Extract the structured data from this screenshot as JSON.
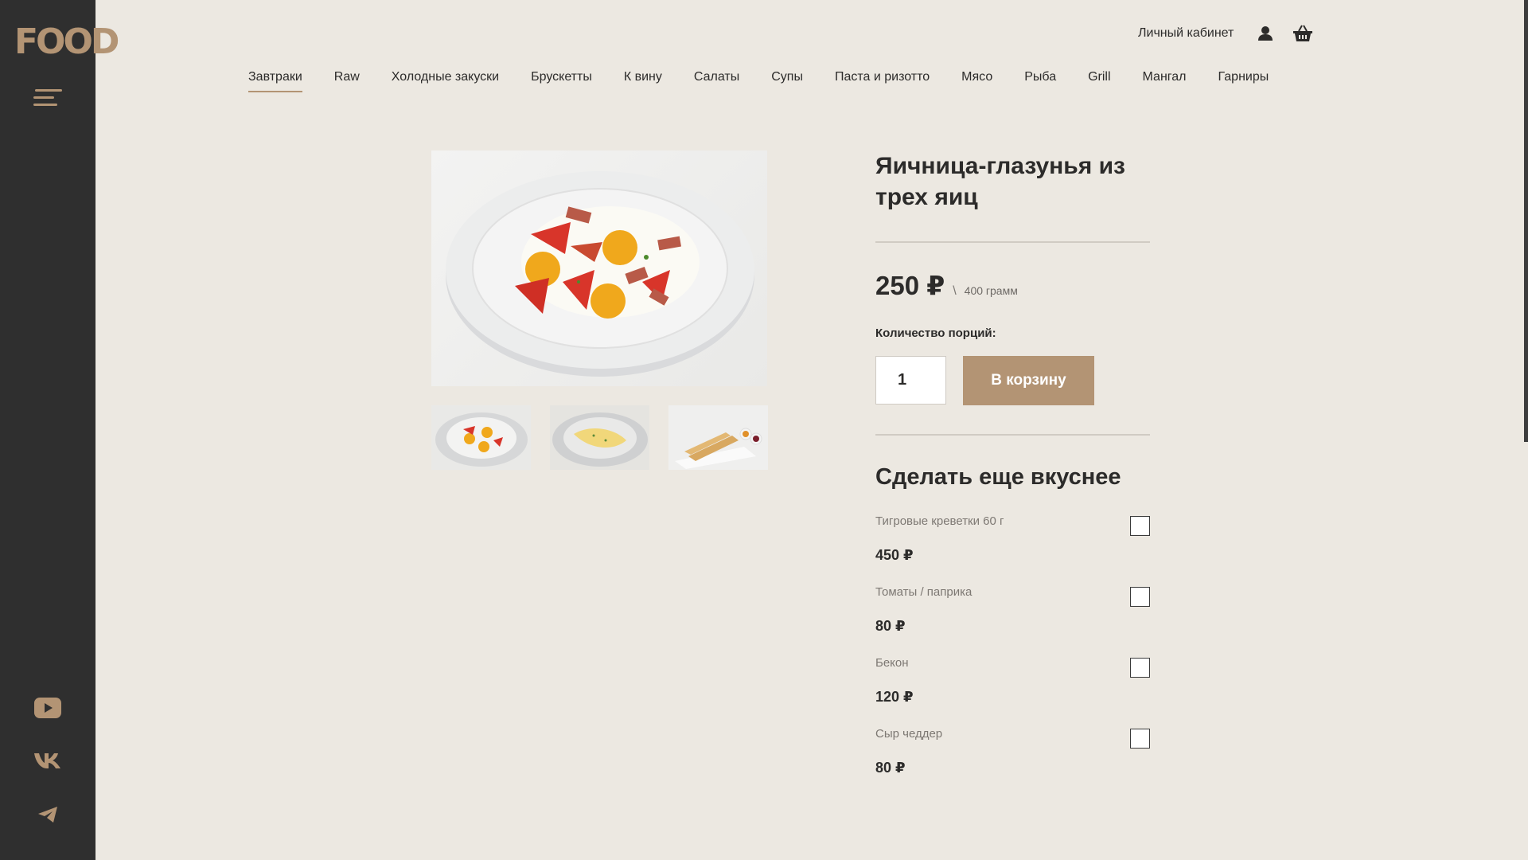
{
  "brand": {
    "logo_text": "FOOD"
  },
  "header": {
    "account_label": "Личный кабинет",
    "icons": {
      "user": "user-icon",
      "basket": "basket-icon"
    }
  },
  "categories": [
    {
      "label": "Завтраки",
      "active": true
    },
    {
      "label": "Raw"
    },
    {
      "label": "Холодные закуски"
    },
    {
      "label": "Брускетты"
    },
    {
      "label": "К вину"
    },
    {
      "label": "Салаты"
    },
    {
      "label": "Супы"
    },
    {
      "label": "Паста и ризотто"
    },
    {
      "label": "Мясо"
    },
    {
      "label": "Рыба"
    },
    {
      "label": "Grill"
    },
    {
      "label": "Мангал"
    },
    {
      "label": "Гарниры"
    }
  ],
  "product": {
    "title": "Яичница-глазунья из трех яиц",
    "price": "250 ₽",
    "price_separator": "\\",
    "weight": "400 грамм",
    "quantity_label": "Количество порций:",
    "quantity_value": "1",
    "add_to_cart_label": "В корзину",
    "images": [
      "fried-eggs-photo",
      "omelette-photo",
      "crepes-photo"
    ]
  },
  "extras": {
    "title": "Сделать еще вкуснее",
    "items": [
      {
        "name": "Тигровые креветки 60 г",
        "price": "450 ₽"
      },
      {
        "name": "Томаты / паприка",
        "price": "80 ₽"
      },
      {
        "name": "Бекон",
        "price": "120 ₽"
      },
      {
        "name": "Сыр чеддер",
        "price": "80 ₽"
      }
    ]
  },
  "social": [
    "youtube-icon",
    "vk-icon",
    "telegram-icon"
  ],
  "colors": {
    "accent": "#b39474",
    "sidebar": "#2f2f2f",
    "background": "#ece8e1",
    "text": "#2c2b2a"
  }
}
